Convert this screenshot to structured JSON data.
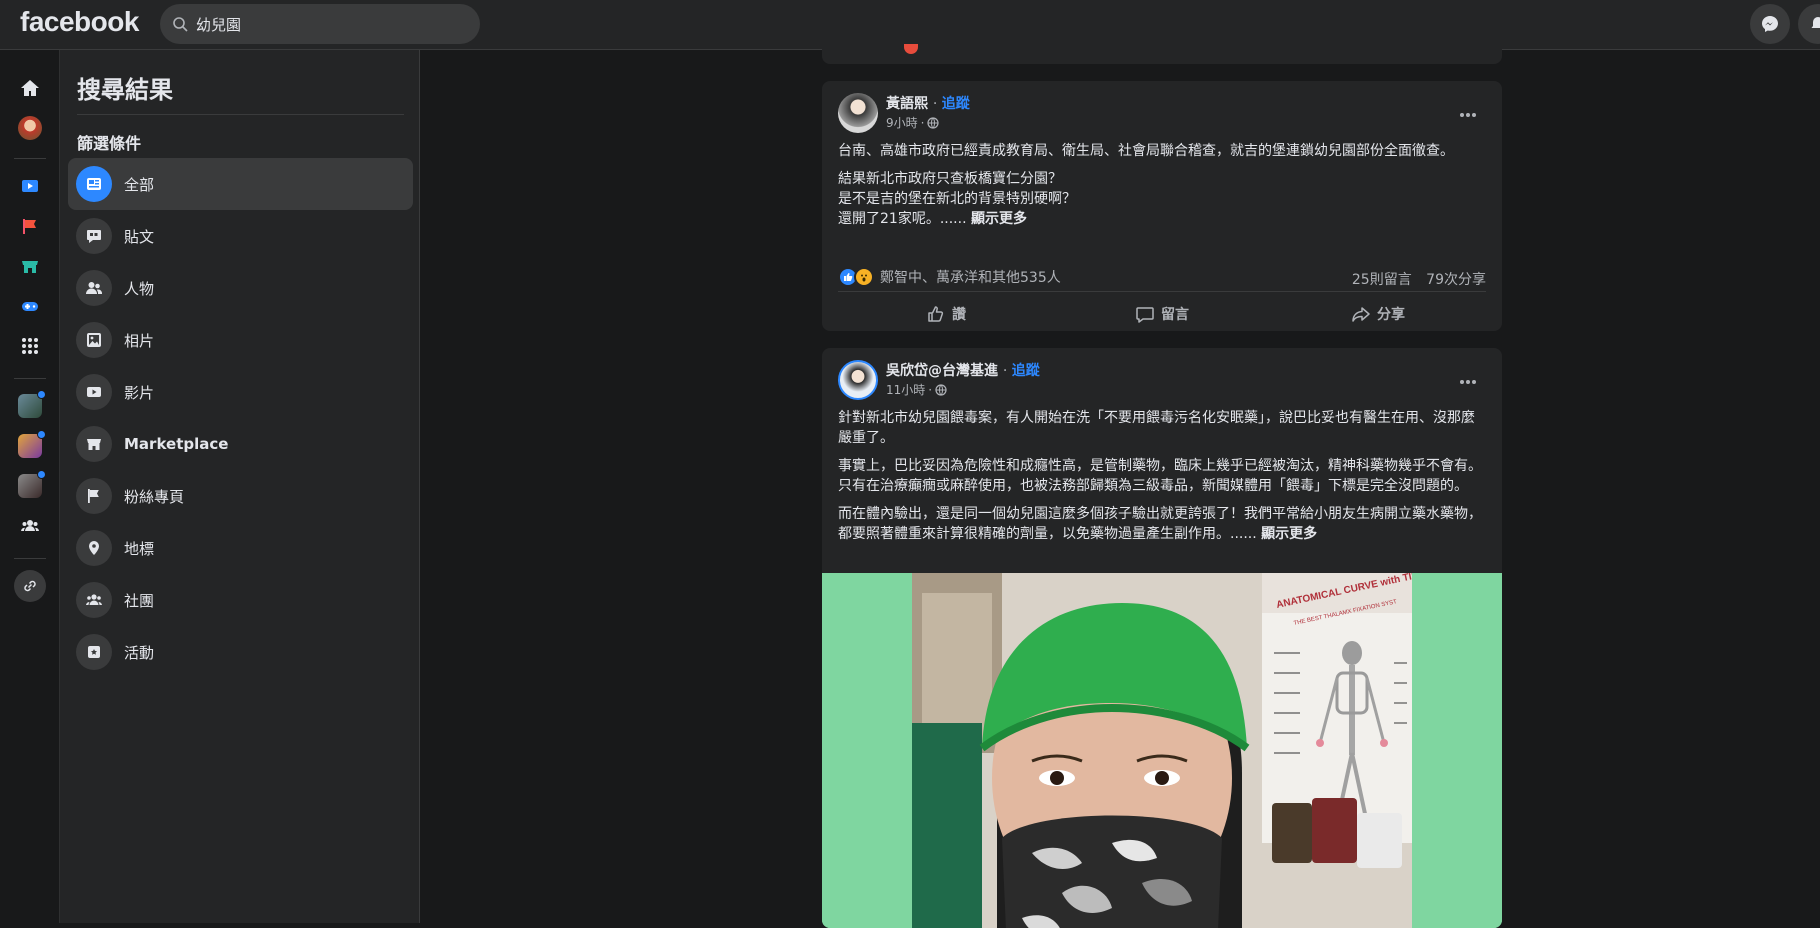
{
  "header": {
    "logo": "facebook",
    "search_value": "幼兒園"
  },
  "sidebar": {
    "title": "搜尋結果",
    "filters_title": "篩選條件",
    "items": [
      {
        "label": "全部",
        "icon": "feed-icon"
      },
      {
        "label": "貼文",
        "icon": "posts-icon"
      },
      {
        "label": "人物",
        "icon": "people-icon"
      },
      {
        "label": "相片",
        "icon": "photos-icon"
      },
      {
        "label": "影片",
        "icon": "video-icon"
      },
      {
        "label": "Marketplace",
        "icon": "marketplace-icon"
      },
      {
        "label": "粉絲專頁",
        "icon": "flag-icon"
      },
      {
        "label": "地標",
        "icon": "location-icon"
      },
      {
        "label": "社團",
        "icon": "groups-icon"
      },
      {
        "label": "活動",
        "icon": "events-icon"
      }
    ]
  },
  "posts": [
    {
      "author": "黃語熙",
      "follow": "追蹤",
      "time": "9小時",
      "paragraphs": [
        "台南、高雄市政府已經責成教育局、衛生局、社會局聯合稽查，就吉的堡連鎖幼兒園部份全面徹查。",
        "結果新北市政府只查板橋寶仁分園？",
        "是不是吉的堡在新北的背景特別硬啊？",
        "還開了21家呢。......"
      ],
      "see_more": "顯示更多",
      "reactions": "鄭智中、萬承洋和其他535人",
      "comments": "25則留言",
      "shares": "79次分享",
      "like": "讚",
      "comment": "留言",
      "share": "分享"
    },
    {
      "author": "吳欣岱@台灣基進",
      "follow": "追蹤",
      "time": "11小時",
      "paragraphs": [
        "針對新北市幼兒園餵毒案，有人開始在洗「不要用餵毒污名化安眠藥」，說巴比妥也有醫生在用、沒那麼嚴重了。",
        "事實上，巴比妥因為危險性和成癮性高，是管制藥物，臨床上幾乎已經被淘汰，精神科藥物幾乎不會有。只有在治療癲癇或麻醉使用，也被法務部歸類為三級毒品，新聞媒體用「餵毒」下標是完全沒問題的。",
        "而在體內驗出，還是同一個幼兒園這麼多個孩子驗出就更誇張了！我們平常給小朋友生病開立藥水藥物，都要照著體重來計算很精確的劑量，以免藥物過量產生副作用。......"
      ],
      "see_more": "顯示更多",
      "photo_text_1": "ANATOMICAL CURVE with TIE",
      "photo_text_2": "THE BEST THALAMX FIXATION SYST"
    }
  ],
  "colors": {
    "accent": "#2d88ff",
    "background": "#18191a",
    "card": "#242526",
    "photo_bg": "#7fd6a0"
  }
}
